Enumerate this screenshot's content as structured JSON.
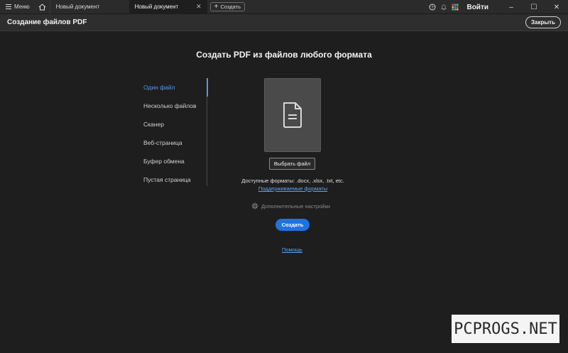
{
  "titlebar": {
    "menu_label": "Меню",
    "tabs": [
      {
        "label": "Новый документ"
      },
      {
        "label": "Новый документ",
        "close": "✕"
      }
    ],
    "new_tab_label": "Создать",
    "signin_label": "Войти",
    "window_controls": {
      "minimize": "–",
      "maximize": "☐",
      "close": "✕"
    },
    "icons": [
      "help-icon",
      "bell-icon",
      "apps-grid-icon"
    ]
  },
  "tool": {
    "title": "Создание файлов PDF",
    "close_label": "Закрыть"
  },
  "main": {
    "heading": "Создать PDF из файлов любого формата",
    "nav": [
      {
        "label": "Один файл",
        "active": true
      },
      {
        "label": "Несколько файлов",
        "active": false
      },
      {
        "label": "Сканер",
        "active": false
      },
      {
        "label": "Веб-страница",
        "active": false
      },
      {
        "label": "Буфер обмена",
        "active": false
      },
      {
        "label": "Пустая страница",
        "active": false
      }
    ],
    "choose_file_label": "Выбрать файл",
    "formats_text": "Доступные форматы: .docx, .xlsx, .txt, etc.",
    "supported_link": "Поддерживаемые форматы",
    "advanced_settings": "Дополнительные настройки",
    "create_label": "Создать",
    "help_link": "Помощь"
  },
  "watermark": "PCPROGS.NET",
  "colors": {
    "accent": "#1e73e0",
    "link": "#5aa3f0",
    "background": "#1e1e1e"
  }
}
